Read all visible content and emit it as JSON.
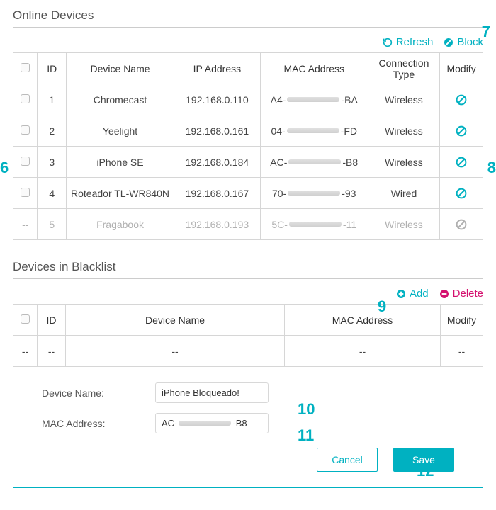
{
  "sections": {
    "online": {
      "title": "Online Devices",
      "refresh": "Refresh",
      "block": "Block",
      "columns": {
        "id": "ID",
        "name": "Device Name",
        "ip": "IP Address",
        "mac": "MAC Address",
        "conn": "Connection Type",
        "mod": "Modify"
      },
      "rows": [
        {
          "id": "1",
          "name": "Chromecast",
          "ip": "192.168.0.110",
          "mac_prefix": "A4-",
          "mac_suffix": "-BA",
          "conn": "Wireless",
          "disabled": false
        },
        {
          "id": "2",
          "name": "Yeelight",
          "ip": "192.168.0.161",
          "mac_prefix": "04-",
          "mac_suffix": "-FD",
          "conn": "Wireless",
          "disabled": false
        },
        {
          "id": "3",
          "name": "iPhone SE",
          "ip": "192.168.0.184",
          "mac_prefix": "AC-",
          "mac_suffix": "-B8",
          "conn": "Wireless",
          "disabled": false
        },
        {
          "id": "4",
          "name": "Roteador TL-WR840N",
          "ip": "192.168.0.167",
          "mac_prefix": "70-",
          "mac_suffix": "-93",
          "conn": "Wired",
          "disabled": false
        },
        {
          "id": "5",
          "name": "Fragabook",
          "ip": "192.168.0.193",
          "mac_prefix": "5C-",
          "mac_suffix": "-11",
          "conn": "Wireless",
          "disabled": true
        }
      ]
    },
    "blacklist": {
      "title": "Devices in Blacklist",
      "add": "Add",
      "delete": "Delete",
      "columns": {
        "id": "ID",
        "name": "Device Name",
        "mac": "MAC Address",
        "mod": "Modify"
      },
      "empty": "--",
      "form": {
        "name_label": "Device Name:",
        "name_value": "iPhone Bloqueado!",
        "mac_label": "MAC Address:",
        "mac_prefix": "AC-",
        "mac_suffix": "-B8",
        "cancel": "Cancel",
        "save": "Save"
      }
    }
  },
  "annotations": {
    "six": "6",
    "seven": "7",
    "eight": "8",
    "nine": "9",
    "ten": "10",
    "eleven": "11",
    "twelve": "12"
  }
}
